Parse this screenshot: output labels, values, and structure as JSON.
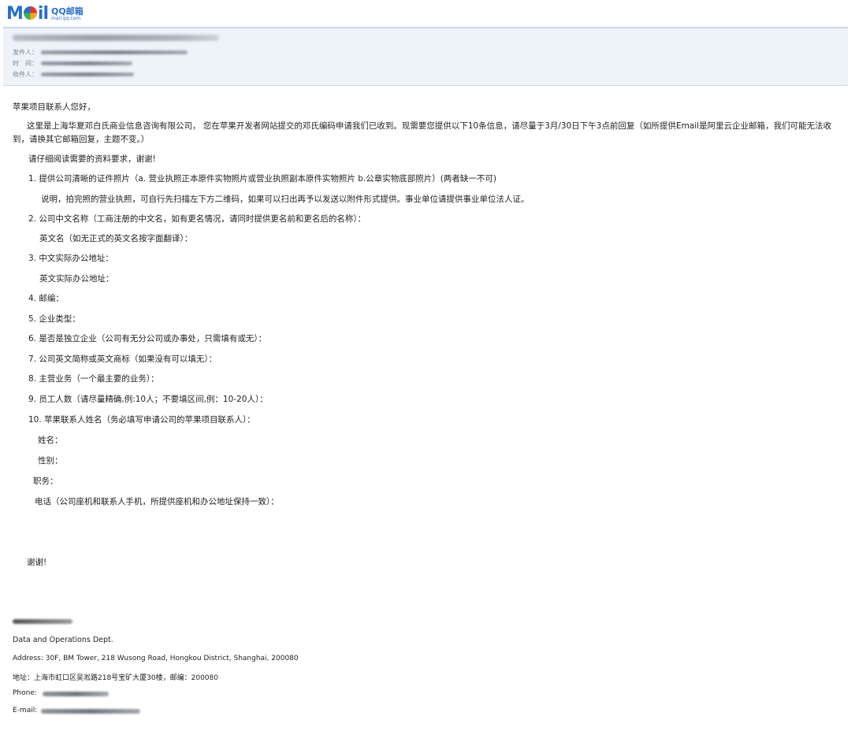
{
  "brand": {
    "logo_text": "MOil",
    "cn": "QQ邮箱",
    "url": "mail.qq.com"
  },
  "header": {
    "from_label": "发件人：",
    "time_label": "时　间：",
    "to_label": "收件人："
  },
  "body": {
    "greeting": "苹果项目联系人您好，",
    "intro": "这里是上海华夏邓白氏商业信息咨询有限公司， 您在苹果开发者网站提交的邓氏编码申请我们已收到。现需要您提供以下10条信息，请尽量于3月/30日下午3点前回复（如所提供Email是阿里云企业邮箱，我们可能无法收到，请换其它邮箱回复，主题不变。）",
    "read_notice": "请仔细阅读需要的资料要求，谢谢!",
    "items": [
      "1.    提供公司清晰的证件照片（a. 营业执照正本原件实物照片或营业执照副本原件实物照片 b.公章实物底部照片）(两者缺一不可)",
      "说明，拍完照的营业执照，可自行先扫描左下方二维码，如果可以扫出再予以发送以附件形式提供。事业单位请提供事业单位法人证。",
      "2.    公司中文名称（工商注册的中文名，如有更名情况，请同时提供更名前和更名后的名称）：",
      "英文名（如无正式的英文名按字面翻译）：",
      "3.    中文实际办公地址：",
      "英文实际办公地址：",
      "4.    邮编：",
      "5.    企业类型：",
      "6.    是否是独立企业（公司有无分公司或办事处，只需填有或无）：",
      "7.    公司英文简称或英文商标（如果没有可以填无）：",
      "8.    主营业务（一个最主要的业务）：",
      "9.    员工人数（请尽量精确,例:10人；不要填区间,例：10-20人）：",
      "10. 苹果联系人姓名（务必填写申请公司的苹果项目联系人）：",
      "姓名：",
      "性别：",
      "职务：",
      "电话（公司座机和联系人手机，所提供座机和办公地址保持一致）："
    ],
    "thanks": "谢谢!"
  },
  "signature": {
    "dept": "Data and Operations Dept.",
    "address_en": "Address: 30F, BM Tower, 218 Wusong Road, Hongkou District, Shanghai, 200080",
    "address_cn": "地址：上海市虹口区吴淞路218号宝矿大厦30楼，邮编：200080",
    "phone_label": "Phone:",
    "email_label": "E-mail:"
  }
}
